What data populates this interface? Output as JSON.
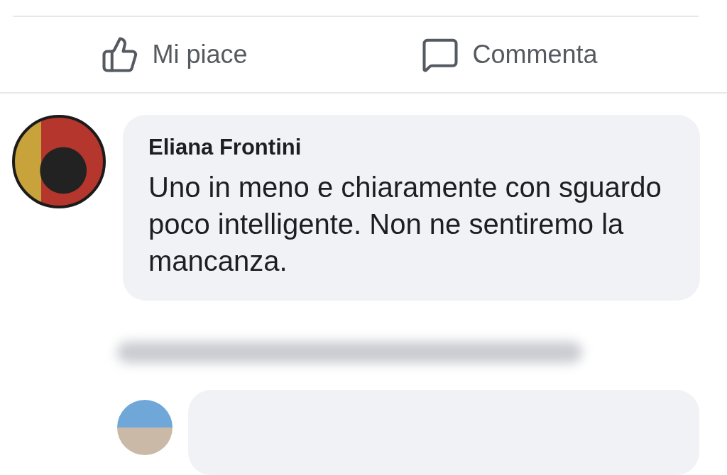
{
  "actions": [
    {
      "kind": "like",
      "label": "Mi piace"
    },
    {
      "kind": "comment",
      "label": "Commenta"
    }
  ],
  "comment": {
    "author": "Eliana Frontini",
    "text": "Uno in meno e chiaramente con sguardo poco intelligente. Non ne sentiremo la mancanza."
  }
}
